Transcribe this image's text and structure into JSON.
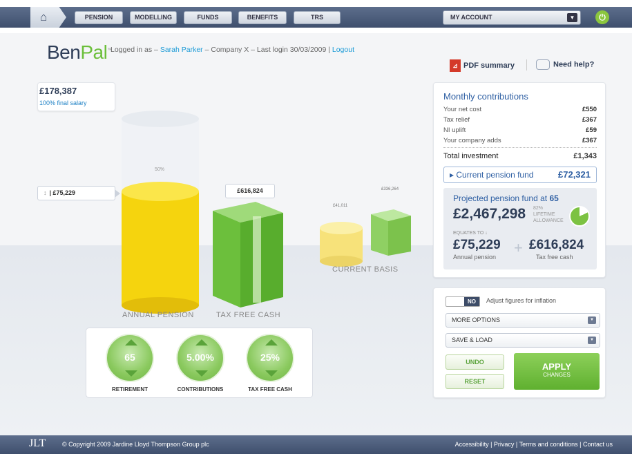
{
  "nav": {
    "home_icon": "home-icon",
    "tabs": [
      "PENSION",
      "MODELLING",
      "FUNDS",
      "BENEFITS",
      "TRS"
    ],
    "account": "MY ACCOUNT"
  },
  "header": {
    "logo_ben": "Ben",
    "logo_pal": "Pal",
    "logo_tm": "™",
    "logged_prefix": "Logged in as – ",
    "user": "Sarah Parker",
    "logged_suffix": " – Company X – Last login 30/03/2009  |  ",
    "logout": "Logout",
    "pdf": "PDF summary",
    "help": "Need help?"
  },
  "visual": {
    "salary_value": "£178,387",
    "salary_sub": "100% final salary",
    "pension_tag": "£75,229",
    "pension_tag_icon": "↕",
    "cash_tag": "£616,824",
    "pct": "50%",
    "current_small_a": "£41,011",
    "current_small_b": "£336,264",
    "label_annual": "ANNUAL PENSION",
    "label_cash": "TAX FREE CASH",
    "label_current": "CURRENT BASIS",
    "colors": {
      "pension": "#f5d40e",
      "cash": "#6cbf3c"
    }
  },
  "dials": [
    {
      "value": "65",
      "label": "RETIREMENT"
    },
    {
      "value": "5.00%",
      "label": "CONTRIBUTIONS"
    },
    {
      "value": "25%",
      "label": "TAX FREE CASH"
    }
  ],
  "monthly": {
    "title": "Monthly contributions",
    "rows": [
      {
        "label": "Your net cost",
        "value": "£550"
      },
      {
        "label": "Tax relief",
        "value": "£367"
      },
      {
        "label": "NI uplift",
        "value": "£59"
      },
      {
        "label": "Your company adds",
        "value": "£367"
      }
    ],
    "total_label": "Total investment",
    "total_value": "£1,343",
    "current_label": "▸ Current pension fund",
    "current_value": "£72,321"
  },
  "projected": {
    "title_prefix": "Projected pension fund at ",
    "age": "65",
    "value": "£2,467,298",
    "lifetime_pct": "82%",
    "lifetime_fraction": 0.82,
    "lifetime_label1": "LIFETIME",
    "lifetime_label2": "ALLOWANCE",
    "equates": "EQUATES TO ↓",
    "annual_value": "£75,229",
    "annual_label": "Annual pension",
    "cash_value": "£616,824",
    "cash_label": "Tax free cash"
  },
  "options": {
    "toggle": "NO",
    "inflation": "Adjust figures for inflation",
    "more": "MORE OPTIONS",
    "save": "SAVE & LOAD",
    "undo": "UNDO",
    "reset": "RESET",
    "apply1": "APPLY",
    "apply2": "CHANGES"
  },
  "footer": {
    "logo": "JLT",
    "copyright": "© Copyright 2009 Jardine Lloyd Thompson Group plc",
    "links": "Accessibility  |  Privacy  |  Terms and conditions  |  Contact us"
  }
}
